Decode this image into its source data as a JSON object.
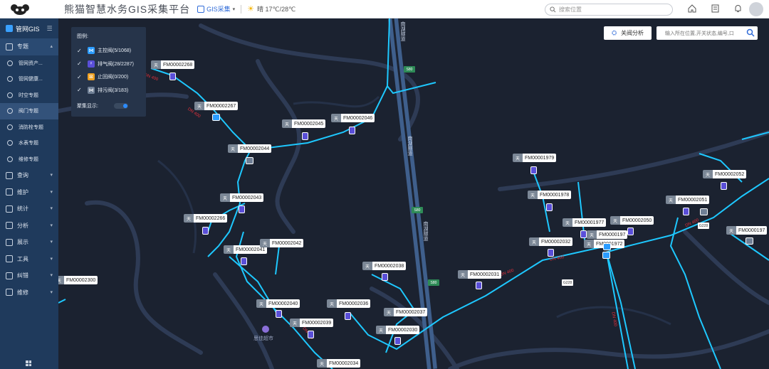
{
  "header": {
    "app_title": "熊猫智慧水务GIS采集平台",
    "mode_label": "GIS采集",
    "weather": "晴 17℃/28℃",
    "search_placeholder": "搜索位置"
  },
  "sidebar": {
    "title": "管网GIS",
    "items": [
      {
        "label": "专题",
        "expanded": true
      },
      {
        "label": "查询"
      },
      {
        "label": "维护"
      },
      {
        "label": "统计"
      },
      {
        "label": "分析"
      },
      {
        "label": "展示"
      },
      {
        "label": "工具"
      },
      {
        "label": "纠错"
      },
      {
        "label": "维修"
      }
    ],
    "subitems": [
      {
        "label": "管网资产..."
      },
      {
        "label": "管网健康..."
      },
      {
        "label": "时空专题"
      },
      {
        "label": "阀门专题",
        "active": true
      },
      {
        "label": "消防栓专题"
      },
      {
        "label": "水表专题"
      },
      {
        "label": "维修专题"
      }
    ]
  },
  "legend": {
    "title": "图例:",
    "rows": [
      {
        "label": "主控阀(5/1068)",
        "color": "#2b9cff"
      },
      {
        "label": "排气阀(28/2287)",
        "color": "#5a4fd8"
      },
      {
        "label": "止回阀(0/200)",
        "color": "#f0a020"
      },
      {
        "label": "排污阀(3/183)",
        "color": "#6f7f95"
      }
    ],
    "cluster_label": "聚集显示:"
  },
  "map": {
    "analysis_button": "关阀分析",
    "search_placeholder": "输入所在位置,开关状态,编号,口",
    "road_names": [
      "南湖隧道",
      "南湖隧道",
      "南湖隧道"
    ],
    "shields": [
      "S80",
      "S80",
      "S80",
      "G228",
      "G228"
    ],
    "poi": "思佳超市",
    "labels": [
      {
        "tag": "天",
        "text": "FM00002268"
      },
      {
        "tag": "天",
        "text": "FM00002267"
      },
      {
        "tag": "天",
        "text": "FM00002045"
      },
      {
        "tag": "天",
        "text": "FM00002046"
      },
      {
        "tag": "天",
        "text": "FM00002044"
      },
      {
        "tag": "天",
        "text": "FM00002043"
      },
      {
        "tag": "天",
        "text": "FM00002266"
      },
      {
        "tag": "天",
        "text": "FM00002041"
      },
      {
        "tag": "天",
        "text": "FM00002042"
      },
      {
        "tag": "天",
        "text": "FM00002300"
      },
      {
        "tag": "天",
        "text": "FM00002040"
      },
      {
        "tag": "天",
        "text": "FM00002039"
      },
      {
        "tag": "天",
        "text": "FM00002036"
      },
      {
        "tag": "天",
        "text": "FM00002038"
      },
      {
        "tag": "天",
        "text": "FM00002037"
      },
      {
        "tag": "天",
        "text": "FM00002030"
      },
      {
        "tag": "天",
        "text": "FM00002034"
      },
      {
        "tag": "天",
        "text": "FM00002031"
      },
      {
        "tag": "天",
        "text": "FM00001979"
      },
      {
        "tag": "天",
        "text": "FM00001978"
      },
      {
        "tag": "天",
        "text": "FM00001977"
      },
      {
        "tag": "天",
        "text": "FM00002050"
      },
      {
        "tag": "天",
        "text": "FM0000197"
      },
      {
        "tag": "天",
        "text": "FM00002032"
      },
      {
        "tag": "天",
        "text": "FM0001972"
      },
      {
        "tag": "天",
        "text": "FM00002051"
      },
      {
        "tag": "天",
        "text": "FM00002052"
      },
      {
        "tag": "天",
        "text": "FM0000197"
      }
    ],
    "pipe_text": "DN 400"
  }
}
